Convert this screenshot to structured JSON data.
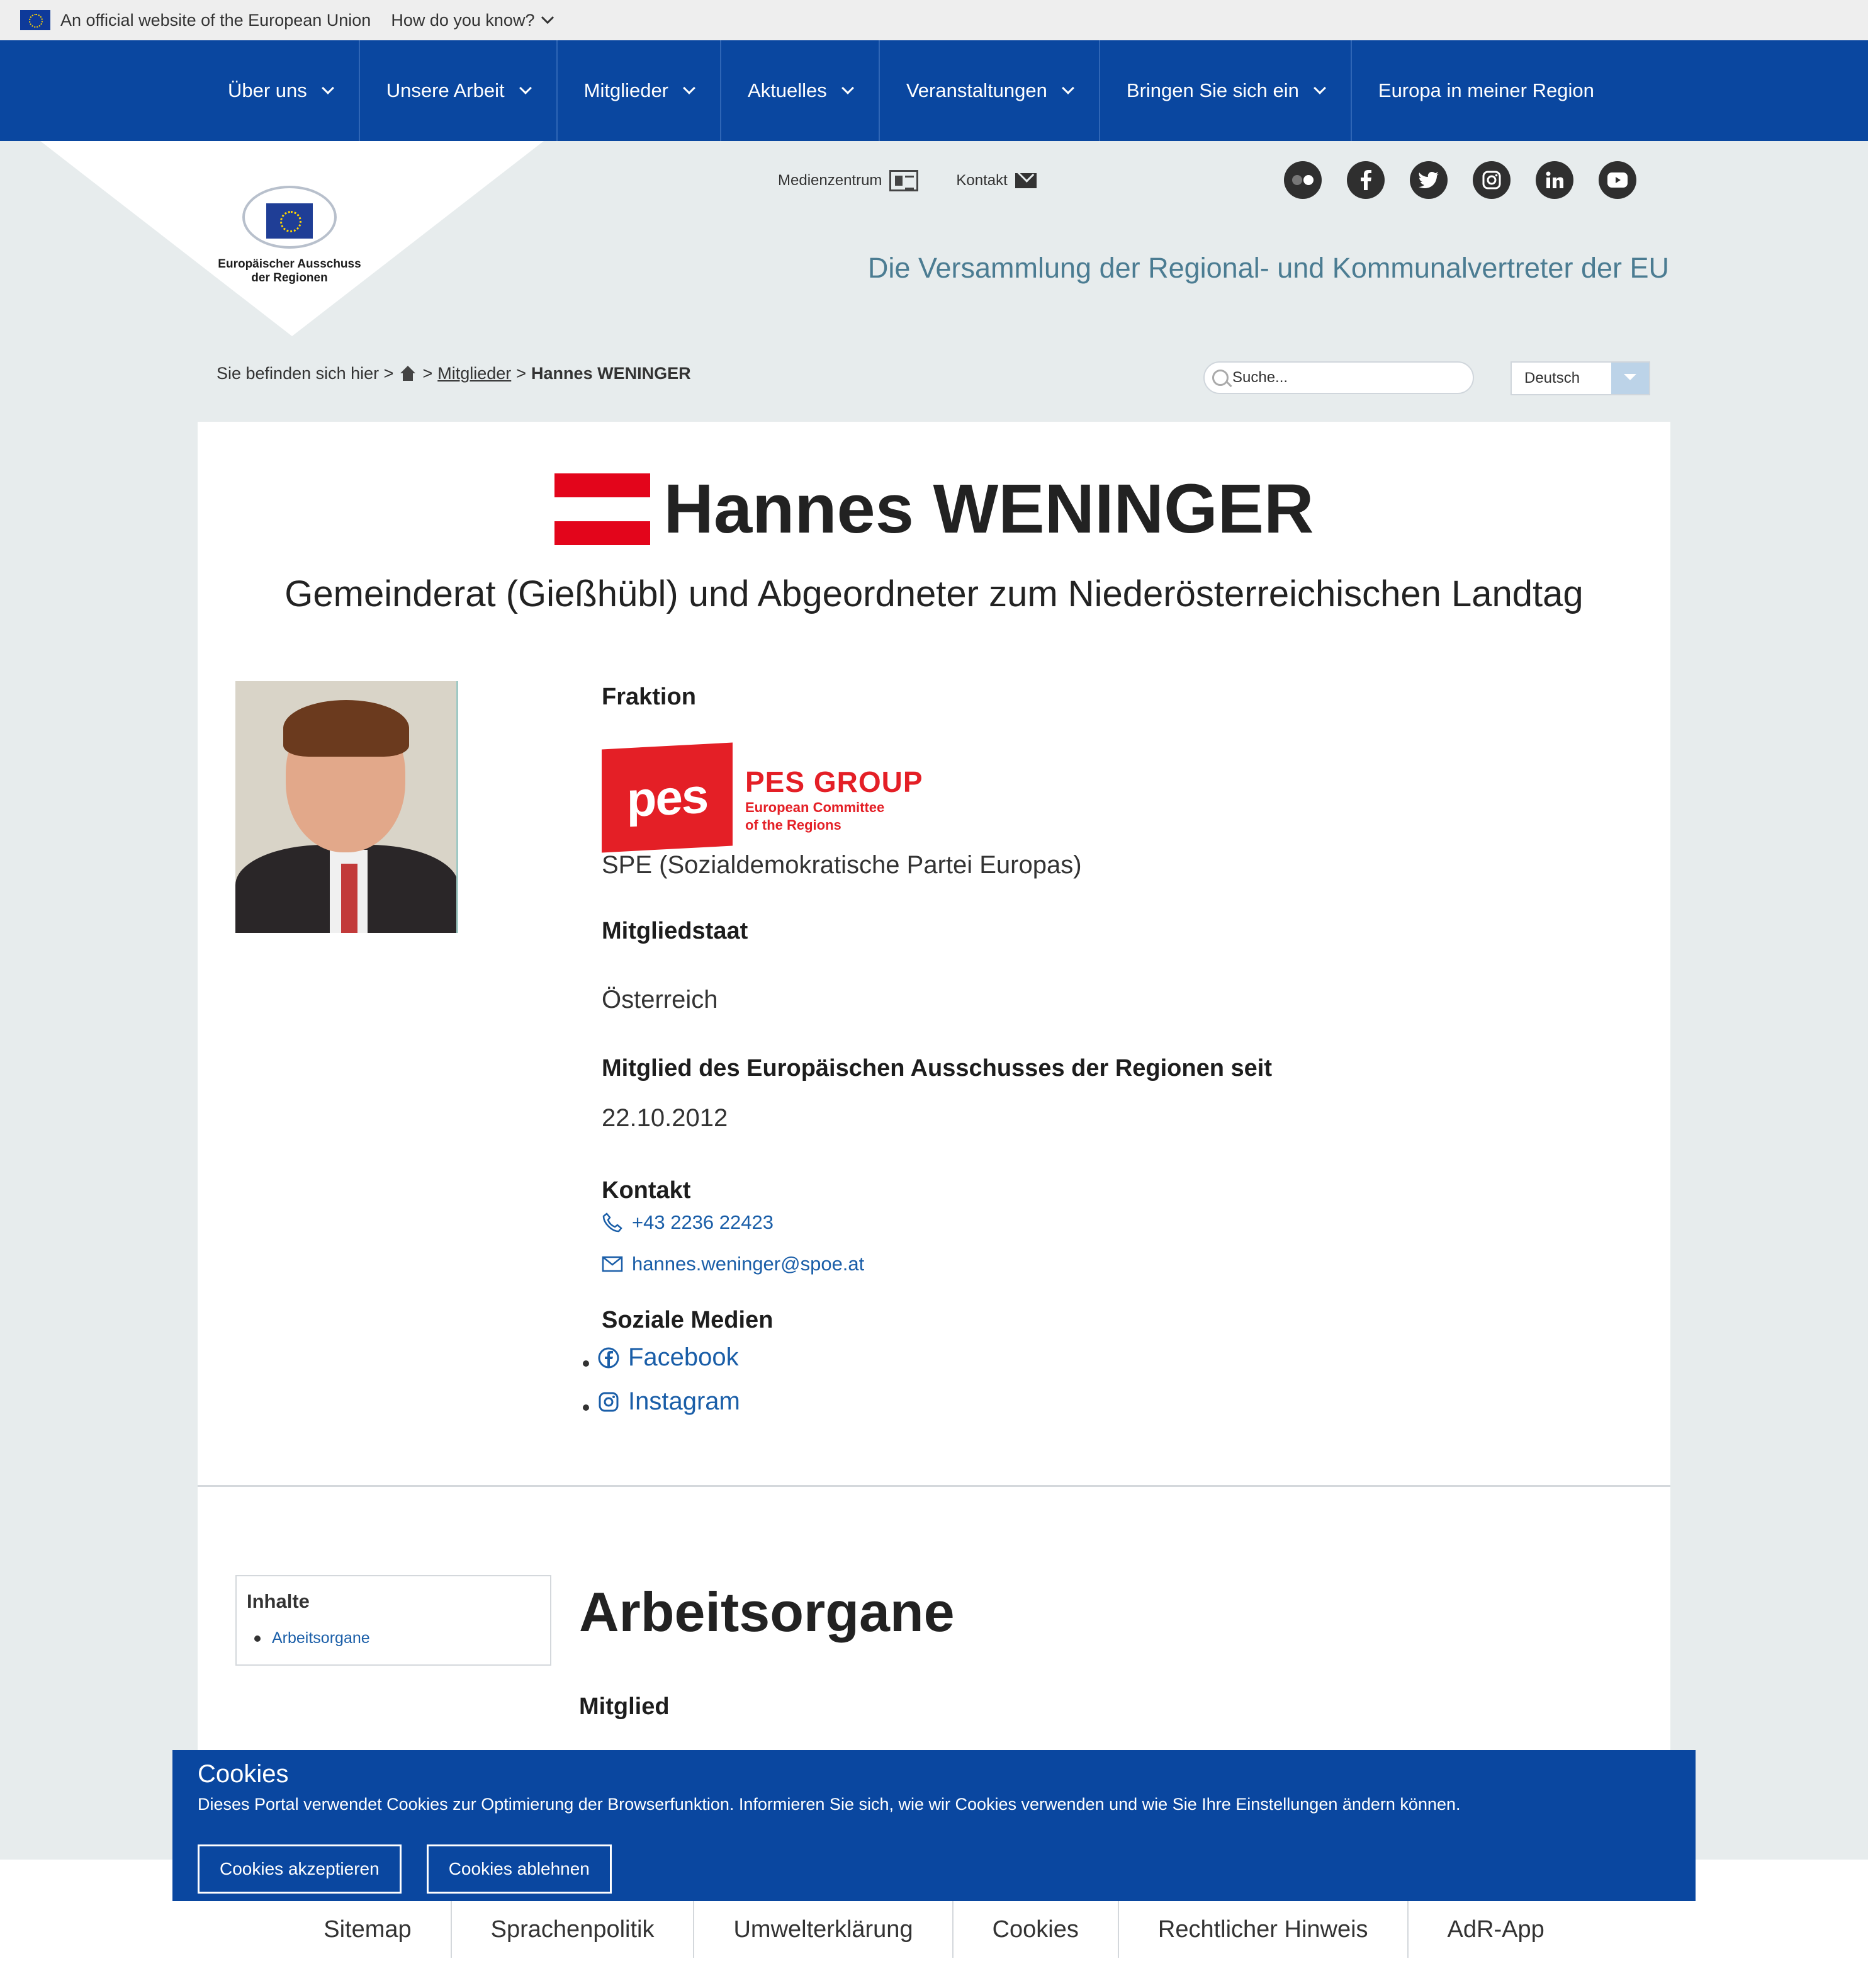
{
  "eu_bar": {
    "official": "An official website of the European Union",
    "how": "How do you know?"
  },
  "nav": [
    {
      "label": "Über uns",
      "dropdown": true
    },
    {
      "label": "Unsere Arbeit",
      "dropdown": true
    },
    {
      "label": "Mitglieder",
      "dropdown": true
    },
    {
      "label": "Aktuelles",
      "dropdown": true
    },
    {
      "label": "Veranstaltungen",
      "dropdown": true
    },
    {
      "label": "Bringen Sie sich ein",
      "dropdown": true
    },
    {
      "label": "Europa in meiner Region",
      "dropdown": false
    }
  ],
  "logo": {
    "line1": "Europäischer Ausschuss",
    "line2": "der Regionen"
  },
  "utility": {
    "media": "Medienzentrum",
    "contact": "Kontakt"
  },
  "socials": [
    "flickr-icon",
    "facebook-icon",
    "twitter-icon",
    "instagram-icon",
    "linkedin-icon",
    "youtube-icon"
  ],
  "tagline": "Die Versammlung der Regional- und Kommunalvertreter der EU",
  "breadcrumb": {
    "prefix": "Sie befinden sich hier >",
    "sep": ">",
    "members": "Mitglieder",
    "current": "Hannes WENINGER"
  },
  "search": {
    "placeholder": "Suche..."
  },
  "language": {
    "selected": "Deutsch"
  },
  "profile": {
    "name": "Hannes WENINGER",
    "subtitle": "Gemeinderat (Gießhübl) und Abgeordneter zum Niederösterreichischen Landtag",
    "flag_colors": [
      "#e3051b",
      "#ffffff",
      "#e3051b"
    ],
    "faction_label": "Fraktion",
    "pes_logo": {
      "mark": "pes",
      "group": "PES GROUP",
      "line1": "European Committee",
      "line2": "of the Regions"
    },
    "faction": "SPE (Sozialdemokratische Partei Europas)",
    "state_label": "Mitgliedstaat",
    "state": "Österreich",
    "since_label": "Mitglied des Europäischen Ausschusses der Regionen seit",
    "since": "22.10.2012",
    "contact_label": "Kontakt",
    "phone": "+43 2236 22423",
    "email": "hannes.weninger@spoe.at",
    "social_label": "Soziale Medien",
    "social_links": [
      "Facebook",
      "Instagram"
    ]
  },
  "toc": {
    "title": "Inhalte",
    "items": [
      "Arbeitsorgane"
    ]
  },
  "section": {
    "title": "Arbeitsorgane",
    "sub": "Mitglied"
  },
  "cookies": {
    "title": "Cookies",
    "text": "Dieses Portal verwendet Cookies zur Optimierung der Browserfunktion. Informieren Sie sich, ",
    "link": "wie wir Cookies verwenden und wie Sie Ihre Einstellungen ändern können",
    "end": ".",
    "accept": "Cookies akzeptieren",
    "decline": "Cookies ablehnen"
  },
  "footer": [
    "Sitemap",
    "Sprachenpolitik",
    "Umwelterklärung",
    "Cookies",
    "Rechtlicher Hinweis",
    "AdR-App"
  ],
  "colors": {
    "nav_bg": "#0a47a0",
    "page_bg": "#e7eced",
    "tagline": "#4b7c92",
    "pes_red": "#e41f26",
    "link": "#1a5ea8"
  }
}
